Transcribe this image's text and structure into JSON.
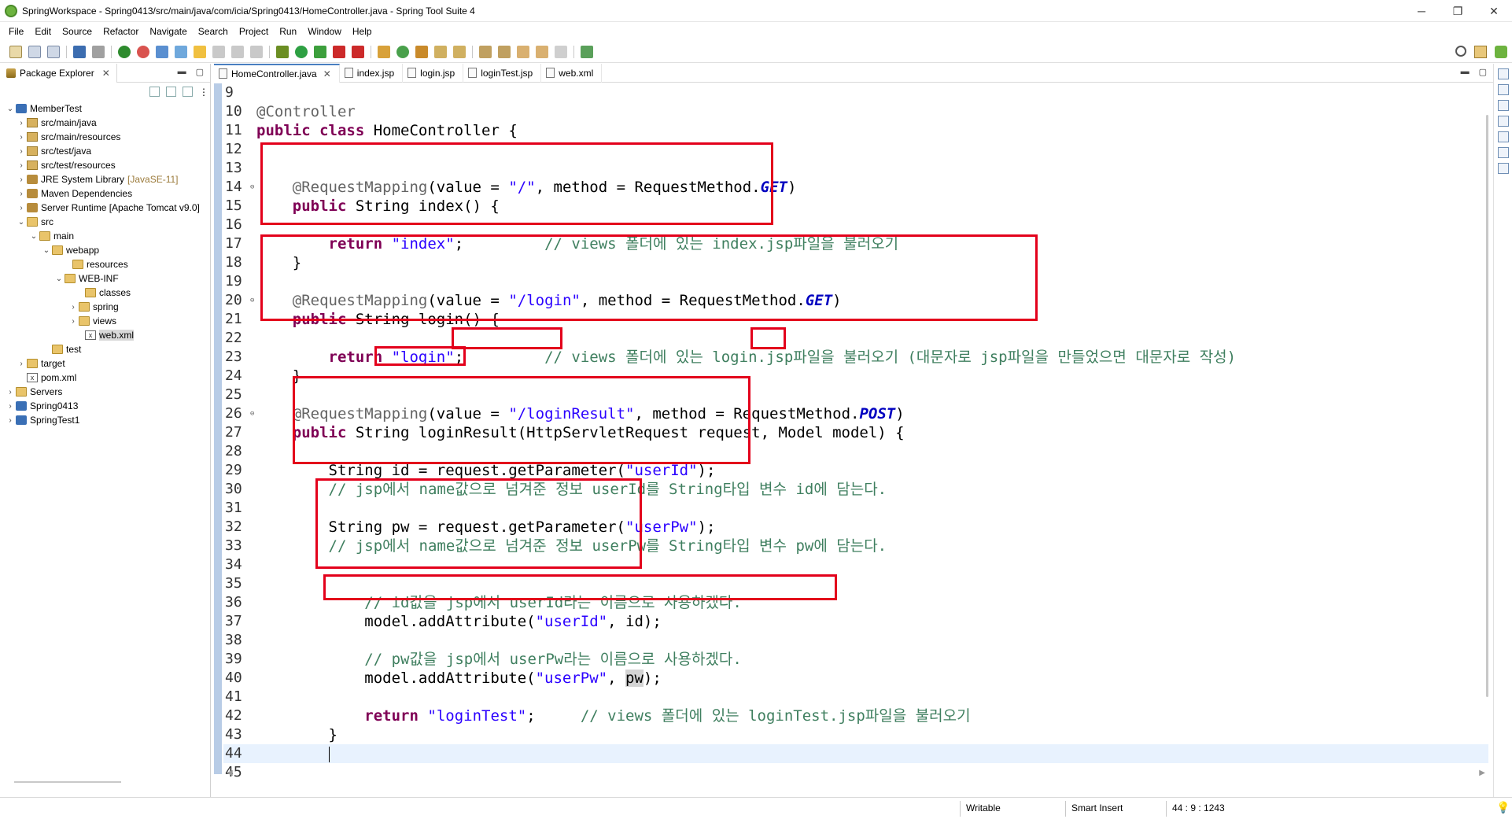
{
  "window": {
    "title": "SpringWorkspace - Spring0413/src/main/java/com/icia/Spring0413/HomeController.java - Spring Tool Suite 4",
    "minimize": "─",
    "maximize": "❐",
    "close": "✕"
  },
  "menu": [
    "File",
    "Edit",
    "Source",
    "Refactor",
    "Navigate",
    "Search",
    "Project",
    "Run",
    "Window",
    "Help"
  ],
  "explorer": {
    "tab_label": "Package Explorer",
    "tree": [
      {
        "label": "MemberTest",
        "twisty": "⌄",
        "icon": "project-icon"
      },
      {
        "label": "src/main/java",
        "twisty": "›",
        "icon": "package-folder-icon"
      },
      {
        "label": "src/main/resources",
        "twisty": "›",
        "icon": "package-folder-icon"
      },
      {
        "label": "src/test/java",
        "twisty": "›",
        "icon": "package-folder-icon"
      },
      {
        "label": "src/test/resources",
        "twisty": "›",
        "icon": "package-folder-icon"
      },
      {
        "label": "JRE System Library",
        "extra": "[JavaSE-11]",
        "twisty": "›",
        "icon": "library-icon"
      },
      {
        "label": "Maven Dependencies",
        "twisty": "›",
        "icon": "library-icon"
      },
      {
        "label": "Server Runtime [Apache Tomcat v9.0]",
        "twisty": "›",
        "icon": "library-icon"
      },
      {
        "label": "src",
        "twisty": "⌄",
        "icon": "folder-icon"
      },
      {
        "label": "main",
        "twisty": "⌄",
        "icon": "folder-icon"
      },
      {
        "label": "webapp",
        "twisty": "⌄",
        "icon": "folder-icon"
      },
      {
        "label": "resources",
        "twisty": "",
        "icon": "folder-icon"
      },
      {
        "label": "WEB-INF",
        "twisty": "⌄",
        "icon": "folder-icon"
      },
      {
        "label": "classes",
        "twisty": "",
        "icon": "folder-icon"
      },
      {
        "label": "spring",
        "twisty": "›",
        "icon": "folder-icon"
      },
      {
        "label": "views",
        "twisty": "›",
        "icon": "folder-icon"
      },
      {
        "label": "web.xml",
        "twisty": "",
        "icon": "xml-file-icon"
      },
      {
        "label": "test",
        "twisty": "",
        "icon": "folder-icon"
      },
      {
        "label": "target",
        "twisty": "›",
        "icon": "folder-icon"
      },
      {
        "label": "pom.xml",
        "twisty": "",
        "icon": "xml-file-icon"
      },
      {
        "label": "Servers",
        "twisty": "›",
        "icon": "folder-icon"
      },
      {
        "label": "Spring0413",
        "twisty": "›",
        "icon": "project-icon"
      },
      {
        "label": "SpringTest1",
        "twisty": "›",
        "icon": "project-icon"
      }
    ]
  },
  "editor_tabs": [
    "HomeController.java",
    "index.jsp",
    "login.jsp",
    "loginTest.jsp",
    "web.xml"
  ],
  "code_lines": [
    {
      "n": "9",
      "text": ""
    },
    {
      "n": "10",
      "text": "@Controller"
    },
    {
      "n": "11",
      "text": "public class HomeController {"
    },
    {
      "n": "12",
      "text": ""
    },
    {
      "n": "13",
      "text": ""
    },
    {
      "n": "14",
      "text": "    @RequestMapping(value = \"/\", method = RequestMethod.GET)"
    },
    {
      "n": "15",
      "text": "    public String index() {"
    },
    {
      "n": "16",
      "text": ""
    },
    {
      "n": "17",
      "text": "        return \"index\";         // views 폴더에 있는 index.jsp파일을 불러오기"
    },
    {
      "n": "18",
      "text": "    }"
    },
    {
      "n": "19",
      "text": ""
    },
    {
      "n": "20",
      "text": "    @RequestMapping(value = \"/login\", method = RequestMethod.GET)"
    },
    {
      "n": "21",
      "text": "    public String login() {"
    },
    {
      "n": "22",
      "text": ""
    },
    {
      "n": "23",
      "text": "        return \"login\";         // views 폴더에 있는 login.jsp파일을 불러오기 (대문자로 jsp파일을 만들었으면 대문자로 작성)"
    },
    {
      "n": "24",
      "text": "    }"
    },
    {
      "n": "25",
      "text": ""
    },
    {
      "n": "26",
      "text": "    @RequestMapping(value = \"/loginResult\", method = RequestMethod.POST)"
    },
    {
      "n": "27",
      "text": "    public String loginResult(HttpServletRequest request, Model model) {"
    },
    {
      "n": "28",
      "text": ""
    },
    {
      "n": "29",
      "text": "        String id = request.getParameter(\"userId\");"
    },
    {
      "n": "30",
      "text": "        // jsp에서 name값으로 넘겨준 정보 userId를 String타입 변수 id에 담는다."
    },
    {
      "n": "31",
      "text": ""
    },
    {
      "n": "32",
      "text": "        String pw = request.getParameter(\"userPw\");"
    },
    {
      "n": "33",
      "text": "        // jsp에서 name값으로 넘겨준 정보 userPw를 String타입 변수 pw에 담는다."
    },
    {
      "n": "34",
      "text": ""
    },
    {
      "n": "35",
      "text": ""
    },
    {
      "n": "36",
      "text": "            // id값을 jsp에서 userId라는 이름으로 사용하겠다."
    },
    {
      "n": "37",
      "text": "            model.addAttribute(\"userId\", id);"
    },
    {
      "n": "38",
      "text": ""
    },
    {
      "n": "39",
      "text": "            // pw값을 jsp에서 userPw라는 이름으로 사용하겠다."
    },
    {
      "n": "40",
      "text": "            model.addAttribute(\"userPw\", pw);"
    },
    {
      "n": "41",
      "text": ""
    },
    {
      "n": "42",
      "text": "            return \"loginTest\";     // views 폴더에 있는 loginTest.jsp파일을 불러오기"
    },
    {
      "n": "43",
      "text": "        }"
    },
    {
      "n": "44",
      "text": ""
    },
    {
      "n": "45",
      "text": ""
    }
  ],
  "status": {
    "writable": "Writable",
    "insert_mode": "Smart Insert",
    "position": "44 : 9 : 1243"
  },
  "colors": {
    "keyword": "#7f0055",
    "string": "#2a00ff",
    "comment": "#3f7f5f",
    "annotation": "#646464",
    "enum_field": "#0000c0",
    "highlight_box": "#e3001b"
  }
}
